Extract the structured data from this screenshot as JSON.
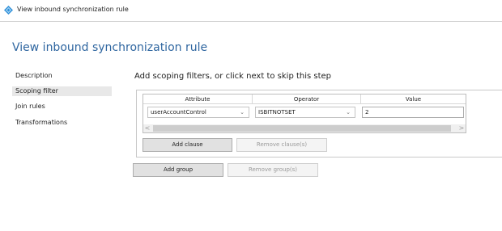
{
  "window": {
    "title": "View inbound synchronization rule",
    "icon": "diamond-app-icon",
    "colors": {
      "accent": "#2f66a0",
      "icon_blue": "#2e8fd8",
      "icon_light": "#9fd0f3"
    }
  },
  "page": {
    "title": "View inbound synchronization rule"
  },
  "sidebar": {
    "items": [
      {
        "label": "Description",
        "selected": false
      },
      {
        "label": "Scoping filter",
        "selected": true
      },
      {
        "label": "Join rules",
        "selected": false
      },
      {
        "label": "Transformations",
        "selected": false
      }
    ]
  },
  "main": {
    "instruction": "Add scoping filters, or click next to skip this step",
    "grid": {
      "headers": [
        "Attribute",
        "Operator",
        "Value"
      ],
      "rows": [
        {
          "attribute": "userAccountControl",
          "operator": "ISBITNOTSET",
          "value": "2"
        }
      ],
      "scroll_left": "<",
      "scroll_right": ">"
    },
    "buttons": {
      "add_clause": "Add clause",
      "remove_clause": "Remove clause(s)",
      "add_group": "Add group",
      "remove_group": "Remove group(s)"
    }
  }
}
